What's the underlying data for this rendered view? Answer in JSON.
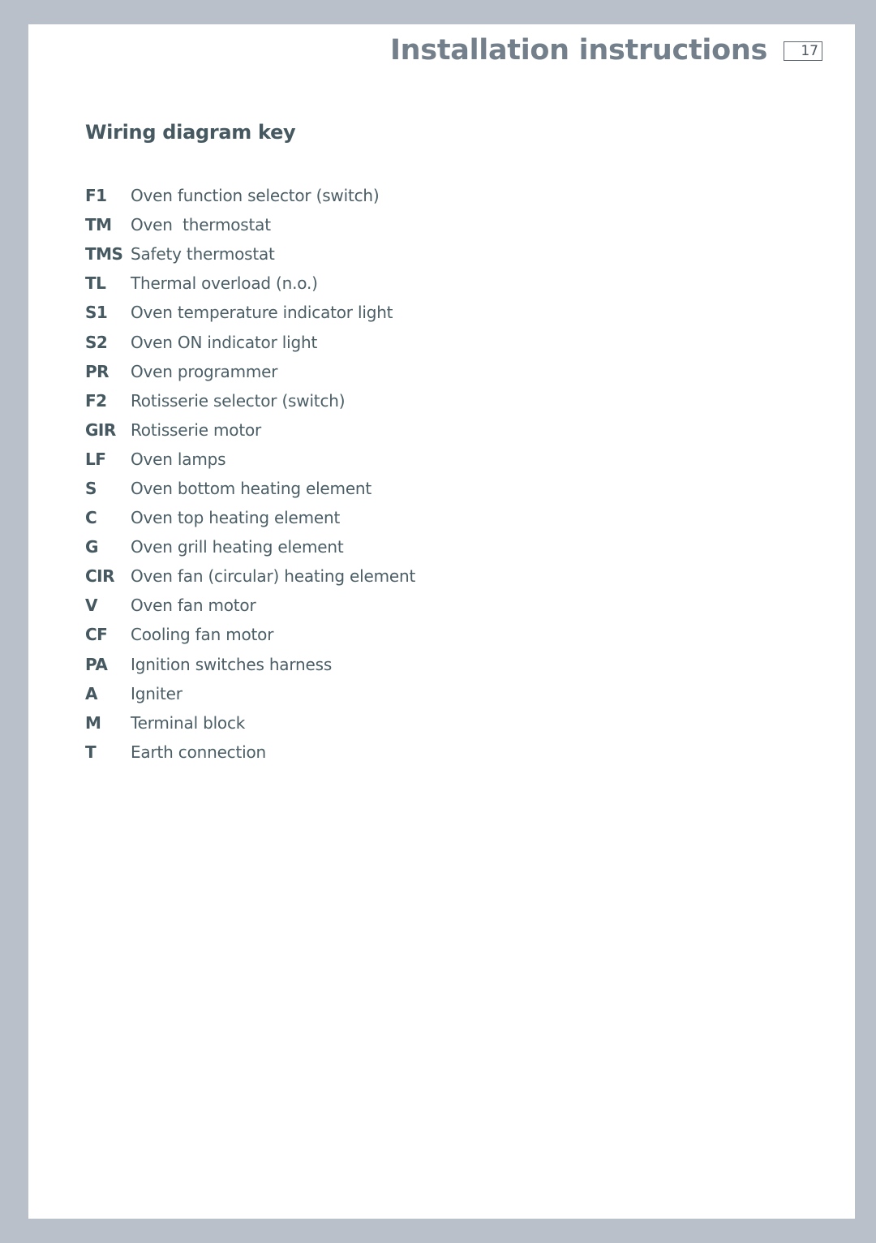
{
  "header": {
    "title": "Installation instructions",
    "page_number": "17"
  },
  "section": {
    "title": "Wiring diagram key"
  },
  "key_items": [
    {
      "code": "F1",
      "description": "Oven function selector (switch)"
    },
    {
      "code": "TM",
      "description": "Oven  thermostat"
    },
    {
      "code": "TMS",
      "description": "Safety thermostat"
    },
    {
      "code": "TL",
      "description": "Thermal overload (n.o.)"
    },
    {
      "code": "S1",
      "description": "Oven temperature indicator light"
    },
    {
      "code": "S2",
      "description": "Oven ON indicator light"
    },
    {
      "code": "PR",
      "description": "Oven programmer"
    },
    {
      "code": "F2",
      "description": "Rotisserie selector (switch)"
    },
    {
      "code": "GIR",
      "description": "Rotisserie motor"
    },
    {
      "code": "LF",
      "description": "Oven lamps"
    },
    {
      "code": "S",
      "description": "Oven bottom heating element"
    },
    {
      "code": "C",
      "description": "Oven top heating element"
    },
    {
      "code": "G",
      "description": "Oven grill heating element"
    },
    {
      "code": "CIR",
      "description": "Oven fan (circular) heating element"
    },
    {
      "code": "V",
      "description": "Oven fan motor"
    },
    {
      "code": "CF",
      "description": "Cooling fan motor"
    },
    {
      "code": "PA",
      "description": "Ignition switches harness"
    },
    {
      "code": "A",
      "description": "Igniter"
    },
    {
      "code": "M",
      "description": "Terminal block"
    },
    {
      "code": "T",
      "description": "Earth connection"
    }
  ]
}
